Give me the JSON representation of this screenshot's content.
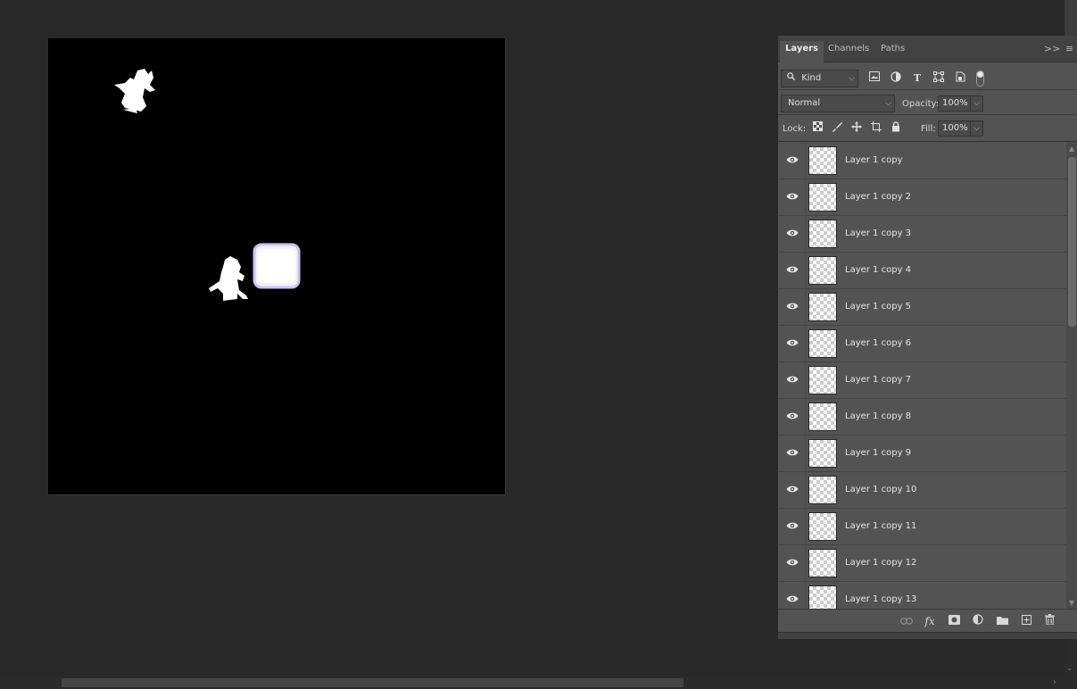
{
  "panel": {
    "tabs": [
      {
        "label": "Layers",
        "active": true
      },
      {
        "label": "Channels",
        "active": false
      },
      {
        "label": "Paths",
        "active": false
      }
    ],
    "collapse_glyph": ">>",
    "menu_glyph": "≡"
  },
  "filter": {
    "kind_label": "Kind",
    "kind_icon": "search-icon",
    "icons": [
      "image-filter-icon",
      "adjustment-filter-icon",
      "type-filter-icon",
      "shape-filter-icon",
      "smart-object-filter-icon"
    ]
  },
  "blend": {
    "mode": "Normal",
    "opacity_label": "Opacity:",
    "opacity_value": "100%"
  },
  "lock": {
    "label": "Lock:",
    "icons": [
      "lock-transparent-icon",
      "lock-pixels-icon",
      "lock-position-icon",
      "lock-artboard-icon",
      "lock-all-icon"
    ],
    "fill_label": "Fill:",
    "fill_value": "100%"
  },
  "layers": [
    {
      "name": "Layer 1 copy",
      "visible": true
    },
    {
      "name": "Layer 1 copy 2",
      "visible": true
    },
    {
      "name": "Layer 1 copy 3",
      "visible": true
    },
    {
      "name": "Layer 1 copy 4",
      "visible": true
    },
    {
      "name": "Layer 1 copy 5",
      "visible": true
    },
    {
      "name": "Layer 1 copy 6",
      "visible": true
    },
    {
      "name": "Layer 1 copy 7",
      "visible": true
    },
    {
      "name": "Layer 1 copy 8",
      "visible": true
    },
    {
      "name": "Layer 1 copy 9",
      "visible": true
    },
    {
      "name": "Layer 1 copy 10",
      "visible": true
    },
    {
      "name": "Layer 1 copy 11",
      "visible": true
    },
    {
      "name": "Layer 1 copy 12",
      "visible": true
    },
    {
      "name": "Layer 1 copy 13",
      "visible": true
    }
  ],
  "bottom_icons": [
    "link-layers-icon",
    "fx-icon",
    "add-mask-icon",
    "new-adjustment-icon",
    "new-group-icon",
    "new-layer-icon",
    "trash-icon"
  ],
  "colors": {
    "canvas": "#000000",
    "workspace": "#282828",
    "panel": "#535353"
  }
}
